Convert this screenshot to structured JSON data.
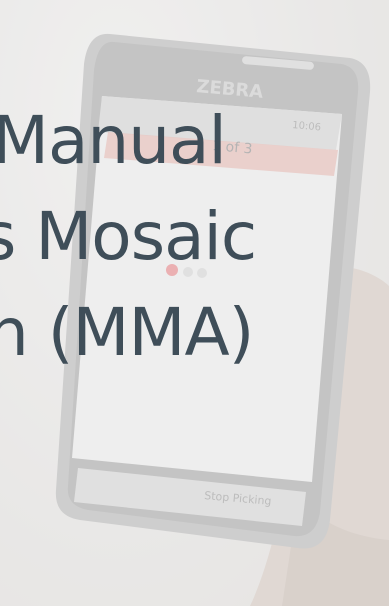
{
  "title_lines": [
    "Manual",
    "s Mosaic",
    "n (MMA)"
  ],
  "device": {
    "brand": "ZEBRA",
    "status_time": "10:06",
    "screen_header": "1 of 3",
    "action_button": "Stop Picking"
  },
  "colors": {
    "title_text": "#3f4e59",
    "background": "#ecebea",
    "device_body": "#b9b9b9",
    "device_screen": "#f5f5f5",
    "accent": "#e86a6f"
  }
}
